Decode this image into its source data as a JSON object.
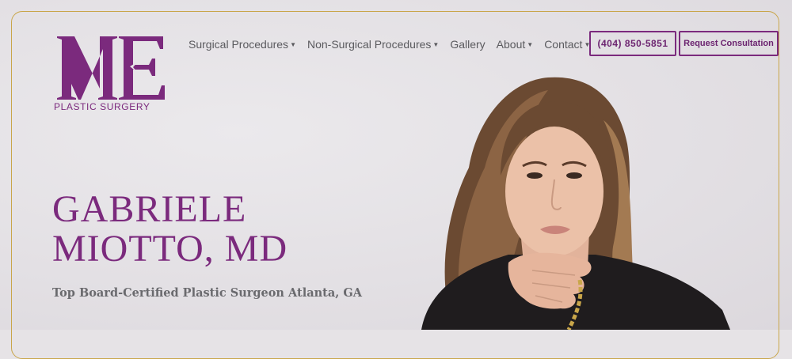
{
  "logo": {
    "monogram_left": "M",
    "monogram_right": "E",
    "subtitle": "PLASTIC SURGERY"
  },
  "nav": {
    "items": [
      {
        "label": "Surgical Procedures",
        "dropdown": true
      },
      {
        "label": "Non-Surgical Procedures",
        "dropdown": true
      },
      {
        "label": "Gallery",
        "dropdown": false
      },
      {
        "label": "About",
        "dropdown": true
      },
      {
        "label": "Contact",
        "dropdown": true
      }
    ],
    "phone_label": "(404) 850-5851",
    "consult_label": "Request Consultation"
  },
  "hero": {
    "name_line1": "GABRIELE",
    "name_line2": "MIOTTO, MD",
    "subtitle": "Top Board-Certified Plastic Surgeon Atlanta, GA"
  },
  "colors": {
    "brand_purple": "#7b2a7d",
    "frame_gold": "#c9a64a",
    "background": "#e6e3e6"
  },
  "icons": {
    "caret": "caret-down-icon"
  }
}
